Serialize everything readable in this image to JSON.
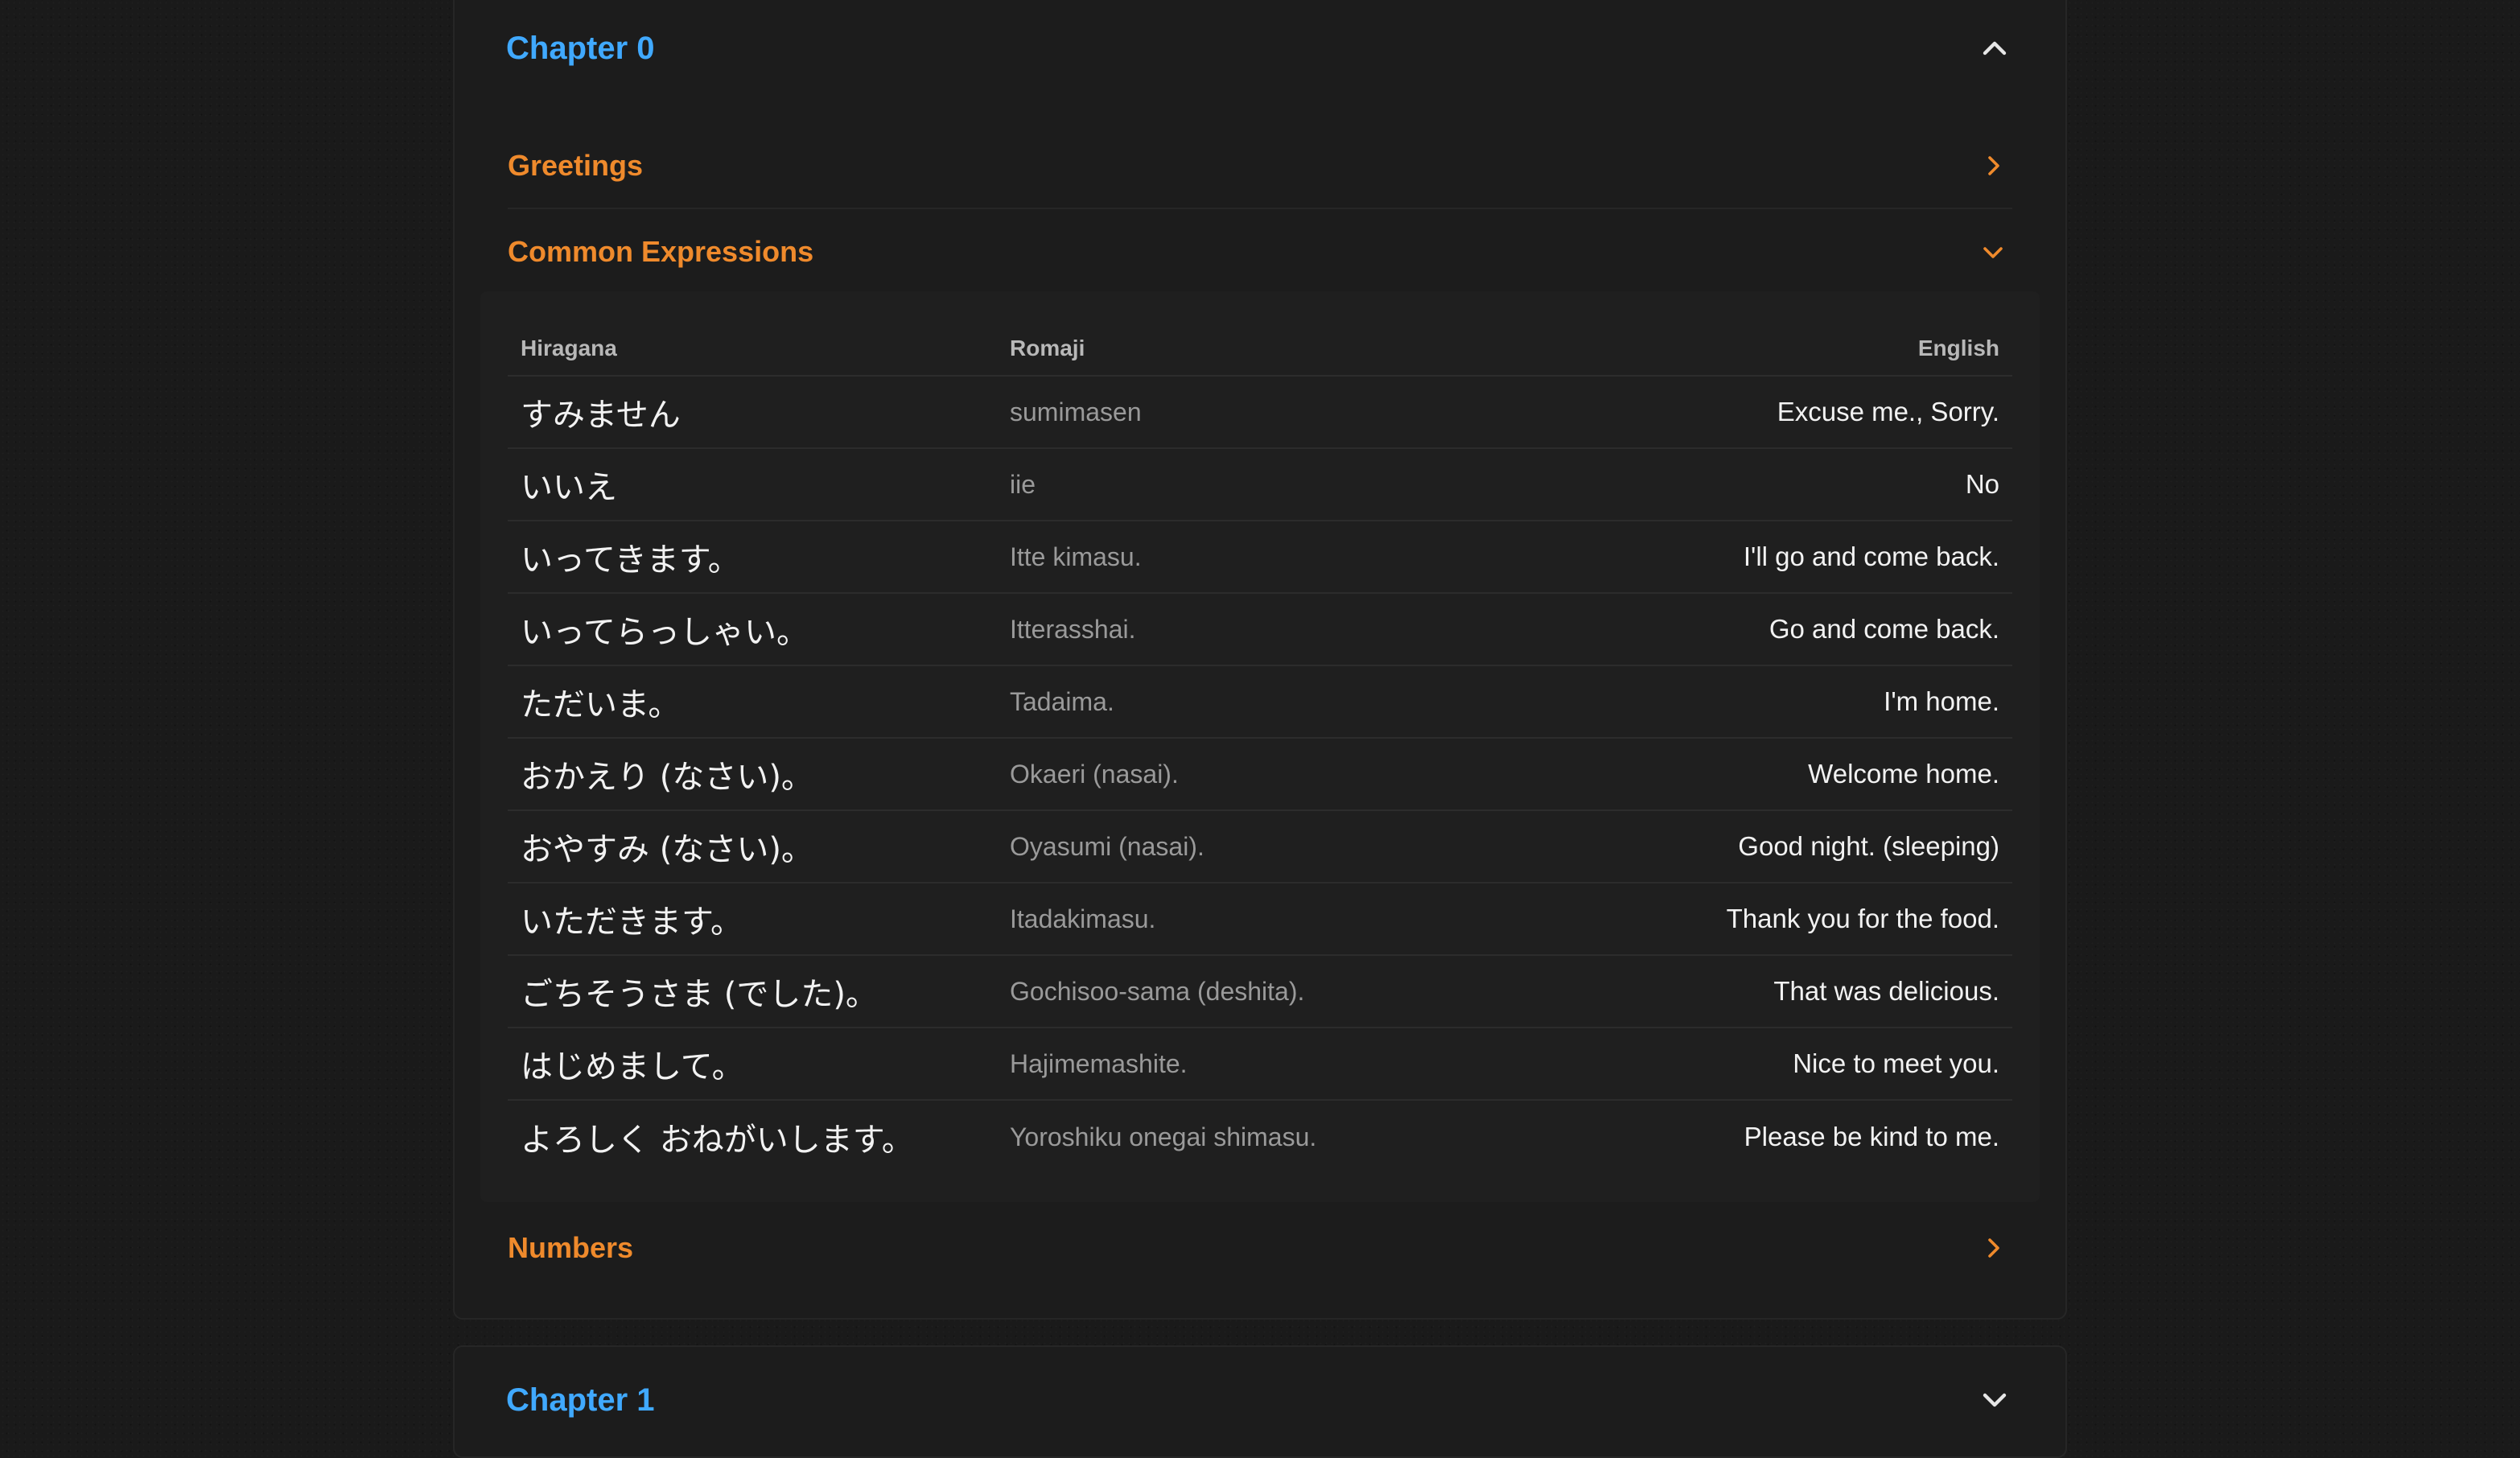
{
  "chapters": [
    {
      "title": "Chapter 0",
      "expanded": true,
      "sections": [
        {
          "title": "Greetings",
          "expanded": false
        },
        {
          "title": "Common Expressions",
          "expanded": true,
          "table": {
            "headers": {
              "hiragana": "Hiragana",
              "romaji": "Romaji",
              "english": "English"
            },
            "rows": [
              {
                "hiragana": "すみません",
                "romaji": "sumimasen",
                "english": "Excuse me., Sorry."
              },
              {
                "hiragana": "いいえ",
                "romaji": "iie",
                "english": "No"
              },
              {
                "hiragana": "いってきます。",
                "romaji": "Itte kimasu.",
                "english": "I'll go and come back."
              },
              {
                "hiragana": "いってらっしゃい。",
                "romaji": "Itterasshai.",
                "english": "Go and come back."
              },
              {
                "hiragana": "ただいま。",
                "romaji": "Tadaima.",
                "english": "I'm home."
              },
              {
                "hiragana": "おかえり (なさい)。",
                "romaji": "Okaeri (nasai).",
                "english": "Welcome home."
              },
              {
                "hiragana": "おやすみ (なさい)。",
                "romaji": "Oyasumi (nasai).",
                "english": "Good night. (sleeping)"
              },
              {
                "hiragana": "いただきます。",
                "romaji": "Itadakimasu.",
                "english": "Thank you for the food."
              },
              {
                "hiragana": "ごちそうさま (でした)。",
                "romaji": "Gochisoo-sama (deshita).",
                "english": "That was delicious."
              },
              {
                "hiragana": "はじめまして。",
                "romaji": "Hajimemashite.",
                "english": "Nice to meet you."
              },
              {
                "hiragana": "よろしく おねがいします。",
                "romaji": "Yoroshiku onegai shimasu.",
                "english": "Please be kind to me."
              }
            ]
          }
        },
        {
          "title": "Numbers",
          "expanded": false
        }
      ]
    },
    {
      "title": "Chapter 1",
      "expanded": false
    }
  ],
  "colors": {
    "chapter_title": "#40a9ff",
    "section_title": "#ef8a2c",
    "background": "#1a1a1a",
    "card": "#1c1c1c"
  },
  "icons": {
    "chapter_expanded": "chevron-up-icon",
    "chapter_collapsed": "chevron-down-icon",
    "section_collapsed": "chevron-right-icon",
    "section_expanded": "chevron-down-icon"
  }
}
